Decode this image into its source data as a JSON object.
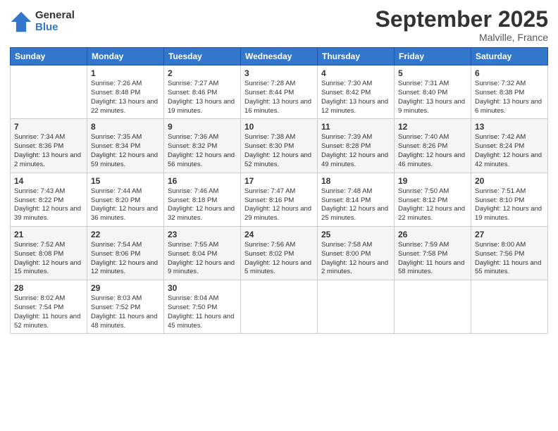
{
  "logo": {
    "general": "General",
    "blue": "Blue"
  },
  "title": "September 2025",
  "location": "Malville, France",
  "days_of_week": [
    "Sunday",
    "Monday",
    "Tuesday",
    "Wednesday",
    "Thursday",
    "Friday",
    "Saturday"
  ],
  "weeks": [
    [
      {
        "day": "",
        "info": ""
      },
      {
        "day": "1",
        "info": "Sunrise: 7:26 AM\nSunset: 8:48 PM\nDaylight: 13 hours and 22 minutes."
      },
      {
        "day": "2",
        "info": "Sunrise: 7:27 AM\nSunset: 8:46 PM\nDaylight: 13 hours and 19 minutes."
      },
      {
        "day": "3",
        "info": "Sunrise: 7:28 AM\nSunset: 8:44 PM\nDaylight: 13 hours and 16 minutes."
      },
      {
        "day": "4",
        "info": "Sunrise: 7:30 AM\nSunset: 8:42 PM\nDaylight: 13 hours and 12 minutes."
      },
      {
        "day": "5",
        "info": "Sunrise: 7:31 AM\nSunset: 8:40 PM\nDaylight: 13 hours and 9 minutes."
      },
      {
        "day": "6",
        "info": "Sunrise: 7:32 AM\nSunset: 8:38 PM\nDaylight: 13 hours and 6 minutes."
      }
    ],
    [
      {
        "day": "7",
        "info": "Sunrise: 7:34 AM\nSunset: 8:36 PM\nDaylight: 13 hours and 2 minutes."
      },
      {
        "day": "8",
        "info": "Sunrise: 7:35 AM\nSunset: 8:34 PM\nDaylight: 12 hours and 59 minutes."
      },
      {
        "day": "9",
        "info": "Sunrise: 7:36 AM\nSunset: 8:32 PM\nDaylight: 12 hours and 56 minutes."
      },
      {
        "day": "10",
        "info": "Sunrise: 7:38 AM\nSunset: 8:30 PM\nDaylight: 12 hours and 52 minutes."
      },
      {
        "day": "11",
        "info": "Sunrise: 7:39 AM\nSunset: 8:28 PM\nDaylight: 12 hours and 49 minutes."
      },
      {
        "day": "12",
        "info": "Sunrise: 7:40 AM\nSunset: 8:26 PM\nDaylight: 12 hours and 46 minutes."
      },
      {
        "day": "13",
        "info": "Sunrise: 7:42 AM\nSunset: 8:24 PM\nDaylight: 12 hours and 42 minutes."
      }
    ],
    [
      {
        "day": "14",
        "info": "Sunrise: 7:43 AM\nSunset: 8:22 PM\nDaylight: 12 hours and 39 minutes."
      },
      {
        "day": "15",
        "info": "Sunrise: 7:44 AM\nSunset: 8:20 PM\nDaylight: 12 hours and 36 minutes."
      },
      {
        "day": "16",
        "info": "Sunrise: 7:46 AM\nSunset: 8:18 PM\nDaylight: 12 hours and 32 minutes."
      },
      {
        "day": "17",
        "info": "Sunrise: 7:47 AM\nSunset: 8:16 PM\nDaylight: 12 hours and 29 minutes."
      },
      {
        "day": "18",
        "info": "Sunrise: 7:48 AM\nSunset: 8:14 PM\nDaylight: 12 hours and 25 minutes."
      },
      {
        "day": "19",
        "info": "Sunrise: 7:50 AM\nSunset: 8:12 PM\nDaylight: 12 hours and 22 minutes."
      },
      {
        "day": "20",
        "info": "Sunrise: 7:51 AM\nSunset: 8:10 PM\nDaylight: 12 hours and 19 minutes."
      }
    ],
    [
      {
        "day": "21",
        "info": "Sunrise: 7:52 AM\nSunset: 8:08 PM\nDaylight: 12 hours and 15 minutes."
      },
      {
        "day": "22",
        "info": "Sunrise: 7:54 AM\nSunset: 8:06 PM\nDaylight: 12 hours and 12 minutes."
      },
      {
        "day": "23",
        "info": "Sunrise: 7:55 AM\nSunset: 8:04 PM\nDaylight: 12 hours and 9 minutes."
      },
      {
        "day": "24",
        "info": "Sunrise: 7:56 AM\nSunset: 8:02 PM\nDaylight: 12 hours and 5 minutes."
      },
      {
        "day": "25",
        "info": "Sunrise: 7:58 AM\nSunset: 8:00 PM\nDaylight: 12 hours and 2 minutes."
      },
      {
        "day": "26",
        "info": "Sunrise: 7:59 AM\nSunset: 7:58 PM\nDaylight: 11 hours and 58 minutes."
      },
      {
        "day": "27",
        "info": "Sunrise: 8:00 AM\nSunset: 7:56 PM\nDaylight: 11 hours and 55 minutes."
      }
    ],
    [
      {
        "day": "28",
        "info": "Sunrise: 8:02 AM\nSunset: 7:54 PM\nDaylight: 11 hours and 52 minutes."
      },
      {
        "day": "29",
        "info": "Sunrise: 8:03 AM\nSunset: 7:52 PM\nDaylight: 11 hours and 48 minutes."
      },
      {
        "day": "30",
        "info": "Sunrise: 8:04 AM\nSunset: 7:50 PM\nDaylight: 11 hours and 45 minutes."
      },
      {
        "day": "",
        "info": ""
      },
      {
        "day": "",
        "info": ""
      },
      {
        "day": "",
        "info": ""
      },
      {
        "day": "",
        "info": ""
      }
    ]
  ]
}
